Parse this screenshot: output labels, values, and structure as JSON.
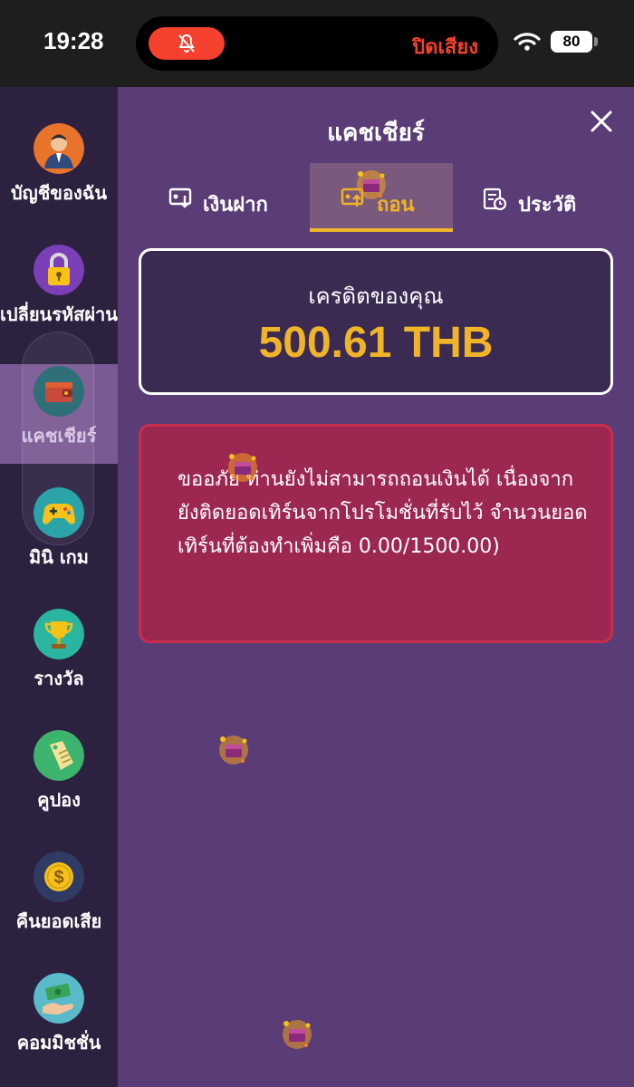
{
  "status_bar": {
    "time": "19:28",
    "mute_text": "ปิดเสียง",
    "battery": "80"
  },
  "sidebar": {
    "items": [
      {
        "label": "บัญชีของฉัน",
        "icon": "user-avatar-icon"
      },
      {
        "label": "เปลี่ยนรหัสผ่าน",
        "icon": "padlock-icon"
      },
      {
        "label": "แคชเชียร์",
        "icon": "wallet-icon"
      },
      {
        "label": "มินิ เกม",
        "icon": "gamepad-icon"
      },
      {
        "label": "รางวัล",
        "icon": "trophy-icon"
      },
      {
        "label": "คูปอง",
        "icon": "coupon-tag-icon"
      },
      {
        "label": "คืนยอดเสีย",
        "icon": "dollar-coin-icon"
      },
      {
        "label": "คอมมิชชั่น",
        "icon": "money-hand-icon"
      }
    ],
    "active_index": 2
  },
  "panel": {
    "title": "แคชเชียร์",
    "tabs": [
      {
        "label": "เงินฝาก",
        "icon": "deposit-icon"
      },
      {
        "label": "ถอน",
        "icon": "withdraw-icon"
      },
      {
        "label": "ประวัติ",
        "icon": "history-icon"
      }
    ],
    "active_tab": 1,
    "credit": {
      "label": "เครดิตของคุณ",
      "amount": "500.61 THB"
    },
    "alert": {
      "message": "ขออภัย ท่านยังไม่สามารถถอนเงินได้ เนื่องจากยังติดยอดเทิร์นจากโปรโมชั่นที่รับไว้ จำนวนยอดเทิร์นที่ต้องทำเพิ่มคือ 0.00/1500.00)"
    }
  },
  "colors": {
    "sidebar_bg": "#2d2140",
    "panel_bg": "#5a3d76",
    "accent_gold": "#f0b429",
    "alert_bg": "#9c2750",
    "mute_red": "#f5412d"
  }
}
